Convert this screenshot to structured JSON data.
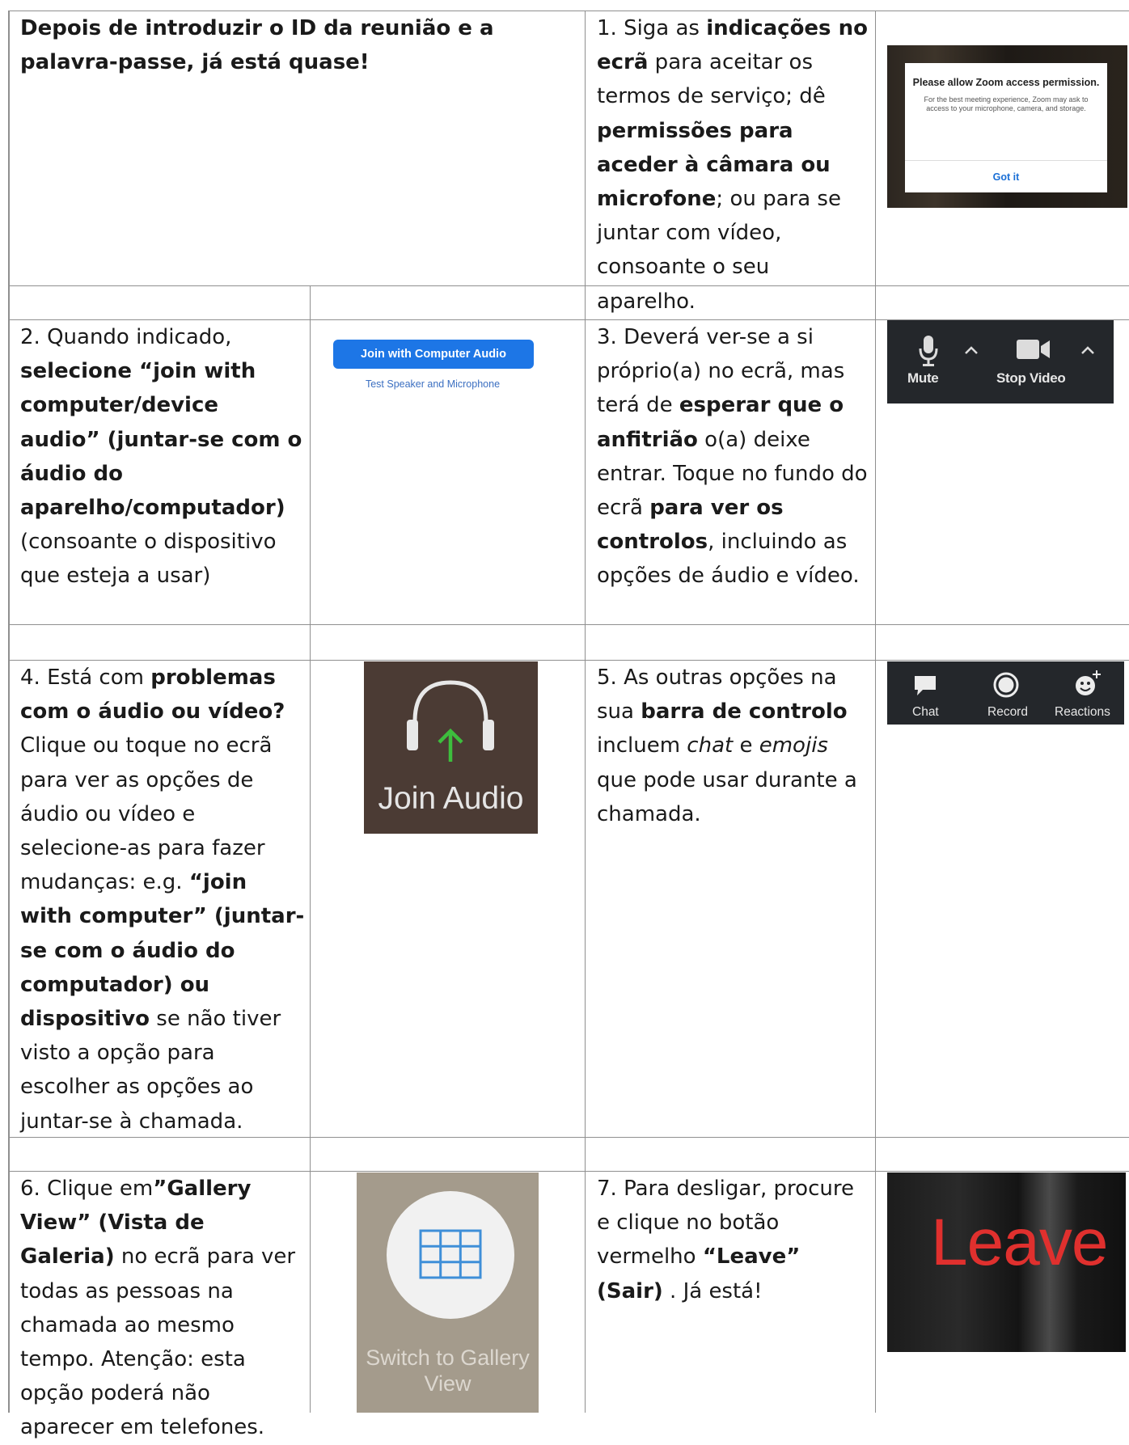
{
  "intro": {
    "text": "Depois de introduzir o ID da reunião e a palavra-passe, já está quase!"
  },
  "steps": {
    "s1": [
      "1. Siga as ",
      "indicações no ecrã",
      " para aceitar os termos de serviço; dê ",
      "permissões para aceder à câmara ou microfone",
      "; ou para se juntar com vídeo, consoante o seu aparelho."
    ],
    "s2": [
      "2. Quando indicado, ",
      "selecione “join with computer/device audio” (juntar-se com o áudio do aparelho/computador)",
      " (consoante o dispositivo que esteja a usar)"
    ],
    "s3": [
      "3. Deverá ver-se a si próprio(a) no ecrã, mas terá de ",
      "esperar que o anfitrião",
      " o(a) deixe entrar. Toque no fundo do ecrã ",
      "para ver os controlos",
      ", incluindo as opções de áudio e vídeo."
    ],
    "s4": [
      "4. Está com ",
      "problemas com o áudio ou vídeo?",
      " Clique ou toque no ecrã para ver as opções de áudio ou vídeo e selecione-as para fazer mudanças: e.g. ",
      "“join with computer” (juntar-se com o áudio do computador) ou dispositivo",
      " se não tiver visto a opção para escolher as opções ao juntar-se à chamada."
    ],
    "s5": [
      "5. As outras opções na sua ",
      "barra de controlo",
      " incluem ",
      "chat",
      " e ",
      "emojis",
      " que pode usar durante a chamada."
    ],
    "s6": [
      "6. Clique em",
      "”Gallery View” (Vista de Galeria)",
      " no ecrã para ver todas as pessoas na chamada ao mesmo tempo. Atenção: esta opção poderá não aparecer em telefones."
    ],
    "s7": [
      "7. Para desligar, procure e clique no botão vermelho ",
      "“Leave” (Sair)",
      " . Já está!"
    ]
  },
  "zoom_permission": {
    "title": "Please allow Zoom access permission.",
    "body": "For the best meeting experience, Zoom may ask to access to your microphone, camera, and storage.",
    "button": "Got it"
  },
  "join_audio_dialog": {
    "button": "Join with Computer Audio",
    "link": "Test Speaker and Microphone"
  },
  "toolbar_av": {
    "mute": "Mute",
    "stop_video": "Stop Video"
  },
  "join_audio_button": {
    "label": "Join Audio"
  },
  "toolbar_extra": {
    "chat": "Chat",
    "record": "Record",
    "reactions": "Reactions"
  },
  "gallery_view": {
    "label": "Switch to Gallery View"
  },
  "leave_button": {
    "label": "Leave"
  }
}
